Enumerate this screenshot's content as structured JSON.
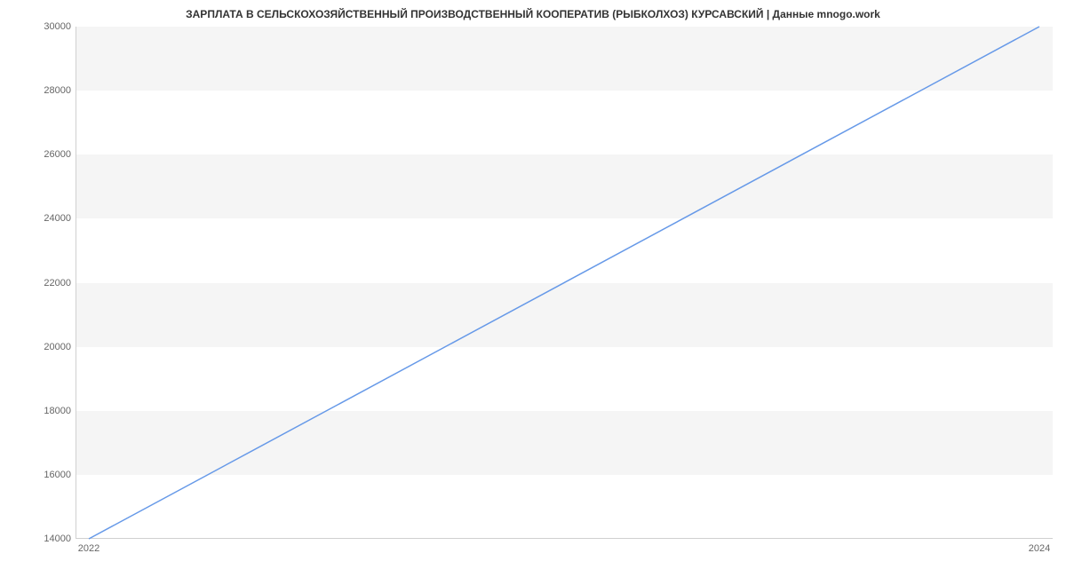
{
  "chart_data": {
    "type": "line",
    "title": "ЗАРПЛАТА В СЕЛЬСКОХОЗЯЙСТВЕННЫЙ ПРОИЗВОДСТВЕННЫЙ КООПЕРАТИВ (РЫБКОЛХОЗ) КУРСАВСКИЙ | Данные mnogo.work",
    "x": [
      2022,
      2024
    ],
    "values": [
      14000,
      30000
    ],
    "x_ticks": [
      2022,
      2024
    ],
    "y_ticks": [
      14000,
      16000,
      18000,
      20000,
      22000,
      24000,
      26000,
      28000,
      30000
    ],
    "xlim": [
      2022,
      2024
    ],
    "ylim": [
      14000,
      30000
    ],
    "xlabel": "",
    "ylabel": "",
    "line_color": "#6699e8",
    "band_color": "#f5f5f5"
  }
}
